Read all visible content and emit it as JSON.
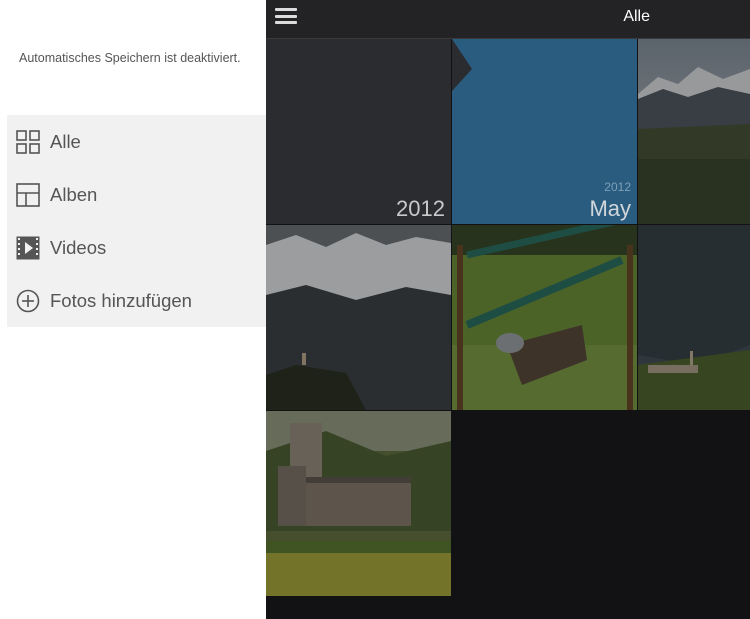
{
  "drawer": {
    "status_text": "Automatisches Speichern ist deaktiviert.",
    "menu": [
      {
        "label": "Alle",
        "icon": "grid-icon"
      },
      {
        "label": "Alben",
        "icon": "album-icon"
      },
      {
        "label": "Videos",
        "icon": "video-icon"
      },
      {
        "label": "Fotos hinzufügen",
        "icon": "plus-circle-icon"
      }
    ]
  },
  "header": {
    "title": "Alle",
    "menu_icon": "hamburger-menu-icon"
  },
  "grid": {
    "year_tile": {
      "year": "2012"
    },
    "month_tile": {
      "year": "2012",
      "month": "May"
    }
  },
  "colors": {
    "accent_blue": "#2a5c80",
    "dark_bg": "#121214",
    "header_bg": "#232326",
    "drawer_menu_bg": "#f1f1f1"
  }
}
